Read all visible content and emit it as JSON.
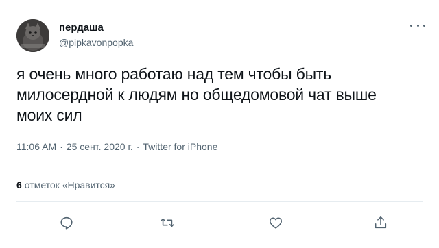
{
  "user": {
    "display_name": "пердаша",
    "handle": "@pipkavonpopka"
  },
  "tweet": {
    "text": "я очень много работаю над тем чтобы быть милосердной к людям но общедомовой чат выше моих сил",
    "time": "11:06 AM",
    "date": "25 сент. 2020 г.",
    "separator": "·",
    "source": "Twitter for iPhone"
  },
  "stats": {
    "likes_count": "6",
    "likes_label": "отметок «Нравится»"
  },
  "icons": {
    "more": "more-icon",
    "reply": "reply-icon",
    "retweet": "retweet-icon",
    "like": "like-icon",
    "share": "share-icon"
  },
  "colors": {
    "text": "#0f1419",
    "secondary": "#536471",
    "divider": "#e6ecf0"
  }
}
